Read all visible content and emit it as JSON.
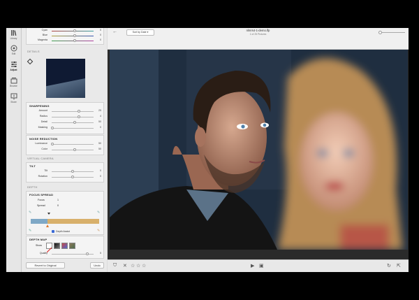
{
  "rail": [
    {
      "label": "Library",
      "icon": "library-icon"
    },
    {
      "label": "Edit",
      "icon": "edit-icon"
    },
    {
      "label": "Adjust",
      "icon": "sliders-icon",
      "active": true
    },
    {
      "label": "Browse",
      "icon": "browse-icon"
    },
    {
      "label": "Share",
      "icon": "share-icon"
    }
  ],
  "color_rows": [
    {
      "name": "Cyan",
      "pos": 0.55,
      "value": "0"
    },
    {
      "name": "Blue",
      "pos": 0.55,
      "value": "0"
    },
    {
      "name": "Magenta",
      "pos": 0.55,
      "value": "0"
    }
  ],
  "details_title": "DETAILS",
  "sharpening": {
    "title": "SHARPENING",
    "rows": [
      {
        "name": "Amount",
        "pos": 0.65,
        "value": "25"
      },
      {
        "name": "Radius",
        "pos": 0.65,
        "value": "4"
      },
      {
        "name": "Detail",
        "pos": 0.55,
        "value": "50"
      },
      {
        "name": "Masking",
        "pos": 0.02,
        "value": "0"
      }
    ]
  },
  "noise": {
    "title": "NOISE REDUCTION",
    "rows": [
      {
        "name": "Luminance",
        "pos": 0.02,
        "value": "50"
      },
      {
        "name": "Color",
        "pos": 0.55,
        "value": "50"
      }
    ]
  },
  "virtual_camera_title": "VIRTUAL CAMERA",
  "tilt": {
    "title": "TILT",
    "rows": [
      {
        "name": "Tilt",
        "pos": 0.55,
        "value": "0"
      },
      {
        "name": "Rotation",
        "pos": 0.55,
        "value": "0"
      }
    ]
  },
  "depth_title": "DEPTH",
  "focus_spread": {
    "title": "FOCUS SPREAD",
    "focus_label": "Focus",
    "focus_value": "1",
    "spread_label": "Spread",
    "spread_value": "0",
    "depth_assist_label": "Depth Assist",
    "depth_assist_checked": true
  },
  "depth_map": {
    "title": "DEPTH MAP",
    "show_label": "Show",
    "quality_label": "Quality",
    "quality_pos": 0.85,
    "quality_value": "5"
  },
  "revert_label": "Revert to Original",
  "undo_label": "Undo",
  "viewer": {
    "sort_label": "Sort by Date",
    "file_name": "nlmrs4-1-demo.lfp",
    "file_count": "1 of 25 Pictures"
  },
  "colors": {
    "accent": "#3a6ad6",
    "pointer": "#e07a2b"
  }
}
